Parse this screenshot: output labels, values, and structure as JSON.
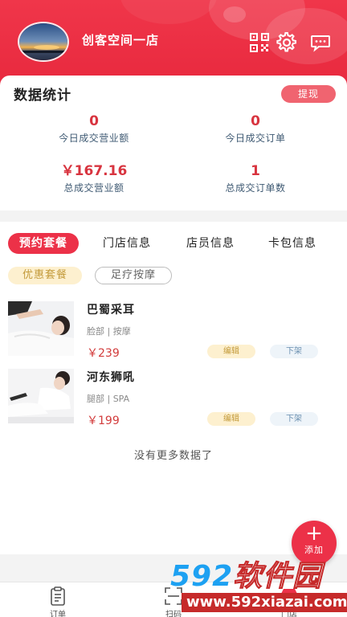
{
  "header": {
    "store_name": "创客空间一店",
    "icons": [
      "qr-code-icon",
      "settings-icon",
      "message-icon"
    ]
  },
  "stats": {
    "title": "数据统计",
    "withdraw_label": "提现",
    "items": [
      {
        "value": "0",
        "label": "今日成交营业额"
      },
      {
        "value": "0",
        "label": "今日成交订单"
      },
      {
        "value": "￥167.16",
        "label": "总成交营业额"
      },
      {
        "value": "1",
        "label": "总成交订单数"
      }
    ]
  },
  "tabs": [
    {
      "label": "预约套餐",
      "active": true
    },
    {
      "label": "门店信息",
      "active": false
    },
    {
      "label": "店员信息",
      "active": false
    },
    {
      "label": "卡包信息",
      "active": false
    }
  ],
  "chips": [
    {
      "label": "优惠套餐",
      "active": true
    },
    {
      "label": "足疗按摩",
      "active": false
    }
  ],
  "packages": [
    {
      "name": "巴蜀采耳",
      "tags": "脸部 | 按摩",
      "price": "￥239",
      "edit_label": "编辑",
      "offline_label": "下架"
    },
    {
      "name": "河东狮吼",
      "tags": "腿部 | SPA",
      "price": "￥199",
      "edit_label": "编辑",
      "offline_label": "下架"
    }
  ],
  "no_more_text": "没有更多数据了",
  "fab": {
    "plus": "+",
    "label": "添加"
  },
  "tabbar": [
    {
      "label": "订单",
      "icon": "order-icon"
    },
    {
      "label": "扫码",
      "icon": "scan-icon"
    },
    {
      "label": "门店",
      "icon": "store-icon"
    }
  ],
  "watermark": {
    "brand_num": "592",
    "brand_text": "软件园",
    "url": "www.592xiazai.com"
  },
  "colors": {
    "primary": "#ec3148",
    "price": "#d23b3b",
    "label": "#3f5a73",
    "chip_gold": "#c39a3a"
  }
}
